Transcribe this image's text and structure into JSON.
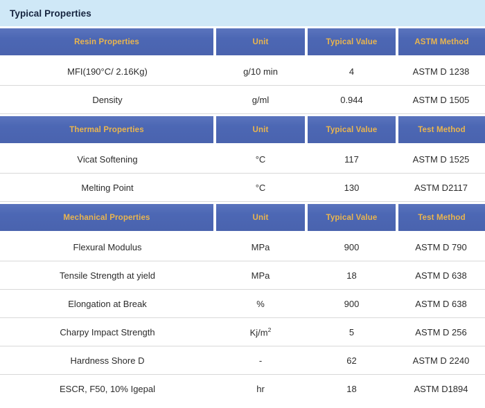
{
  "banner": {
    "title": "Typical Properties",
    "bg_color": "#cfe8f7",
    "text_color": "#16243f"
  },
  "theme": {
    "header_blue": "#4c68b5",
    "header_gold": "#eab54e",
    "row_border": "#d8d8d8",
    "body_text": "#2b2b2b"
  },
  "sections": [
    {
      "headers": [
        "Resin Properties",
        "Unit",
        "Typical Value",
        "ASTM Method"
      ],
      "rows": [
        {
          "property": "MFI(190°C/ 2.16Kg)",
          "unit": "g/10 min",
          "value": "4",
          "method": "ASTM D 1238"
        },
        {
          "property": "Density",
          "unit": "g/ml",
          "value": "0.944",
          "method": "ASTM D 1505"
        }
      ]
    },
    {
      "headers": [
        "Thermal Properties",
        "Unit",
        "Typical Value",
        "Test Method"
      ],
      "rows": [
        {
          "property": "Vicat Softening",
          "unit": "°C",
          "value": "117",
          "method": "ASTM D 1525"
        },
        {
          "property": "Melting Point",
          "unit": "°C",
          "value": "130",
          "method": "ASTM D2117"
        }
      ]
    },
    {
      "headers": [
        "Mechanical Properties",
        "Unit",
        "Typical Value",
        "Test Method"
      ],
      "rows": [
        {
          "property": "Flexural Modulus",
          "unit": "MPa",
          "value": "900",
          "method": "ASTM D 790"
        },
        {
          "property": "Tensile Strength at yield",
          "unit": "MPa",
          "value": "18",
          "method": "ASTM D 638"
        },
        {
          "property": "Elongation at Break",
          "unit": "%",
          "value": "900",
          "method": "ASTM D 638"
        },
        {
          "property": "Charpy Impact Strength",
          "unit": "Kj/m2",
          "unit_base": "Kj/m",
          "unit_sup": "2",
          "value": "5",
          "method": "ASTM D 256"
        },
        {
          "property": "Hardness Shore D",
          "unit": "-",
          "value": "62",
          "method": "ASTM D 2240"
        },
        {
          "property": "ESCR, F50, 10% Igepal",
          "unit": "hr",
          "value": "18",
          "method": "ASTM D1894"
        }
      ]
    }
  ]
}
